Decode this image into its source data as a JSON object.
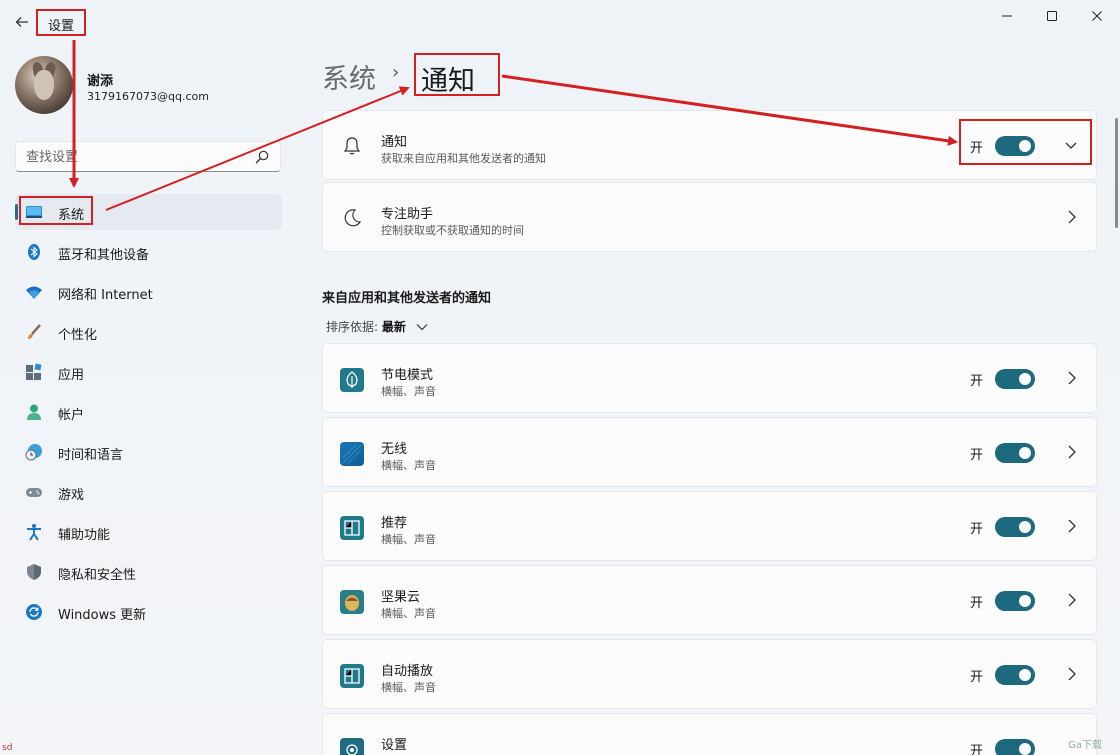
{
  "window": {
    "title": "设置",
    "back_icon": "back-arrow-icon",
    "controls": [
      "minimize-icon",
      "maximize-icon",
      "close-icon"
    ]
  },
  "profile": {
    "name": "谢添",
    "email": "3179167073@qq.com"
  },
  "search": {
    "placeholder": "查找设置"
  },
  "nav": {
    "items": [
      {
        "label": "系统",
        "icon": "monitor-icon",
        "active": true
      },
      {
        "label": "蓝牙和其他设备",
        "icon": "bluetooth-icon"
      },
      {
        "label": "网络和 Internet",
        "icon": "wifi-icon"
      },
      {
        "label": "个性化",
        "icon": "brush-icon"
      },
      {
        "label": "应用",
        "icon": "apps-icon"
      },
      {
        "label": "帐户",
        "icon": "person-icon"
      },
      {
        "label": "时间和语言",
        "icon": "clock-globe-icon"
      },
      {
        "label": "游戏",
        "icon": "gamepad-icon"
      },
      {
        "label": "辅助功能",
        "icon": "accessibility-icon"
      },
      {
        "label": "隐私和安全性",
        "icon": "shield-icon"
      },
      {
        "label": "Windows 更新",
        "icon": "update-icon"
      }
    ]
  },
  "header": {
    "parent": "系统",
    "separator": "›",
    "current": "通知"
  },
  "notification_card": {
    "title": "通知",
    "subtitle": "获取来自应用和其他发送者的通知",
    "toggle_label": "开",
    "toggle_on": true
  },
  "focus_card": {
    "title": "专注助手",
    "subtitle": "控制获取或不获取通知的时间"
  },
  "section": {
    "title": "来自应用和其他发送者的通知",
    "sort_label": "排序依据:",
    "sort_value": "最新"
  },
  "apps": [
    {
      "name": "节电模式",
      "detail": "横幅、声音",
      "toggle_label": "开",
      "on": true,
      "icon": "battery-saver-leaf-icon",
      "color": "#1f7a8c"
    },
    {
      "name": "无线",
      "detail": "横幅、声音",
      "toggle_label": "开",
      "on": true,
      "icon": "wireless-icon",
      "color": "#1b78b5"
    },
    {
      "name": "推荐",
      "detail": "横幅、声音",
      "toggle_label": "开",
      "on": true,
      "icon": "app-window-icon",
      "color": "#1f7a8c"
    },
    {
      "name": "坚果云",
      "detail": "横幅、声音",
      "toggle_label": "开",
      "on": true,
      "icon": "nut-cloud-icon",
      "color": "#2a7d8b"
    },
    {
      "name": "自动播放",
      "detail": "横幅、声音",
      "toggle_label": "开",
      "on": true,
      "icon": "app-window-icon",
      "color": "#1f7a8c"
    },
    {
      "name": "设置",
      "detail": "",
      "toggle_label": "开",
      "on": true,
      "icon": "settings-gear-icon",
      "color": "#1f6a85"
    }
  ],
  "colors": {
    "accent": "#1d6a7f",
    "annotation": "#d42020"
  },
  "watermark": "Ga下载",
  "corner_mark": "sd"
}
